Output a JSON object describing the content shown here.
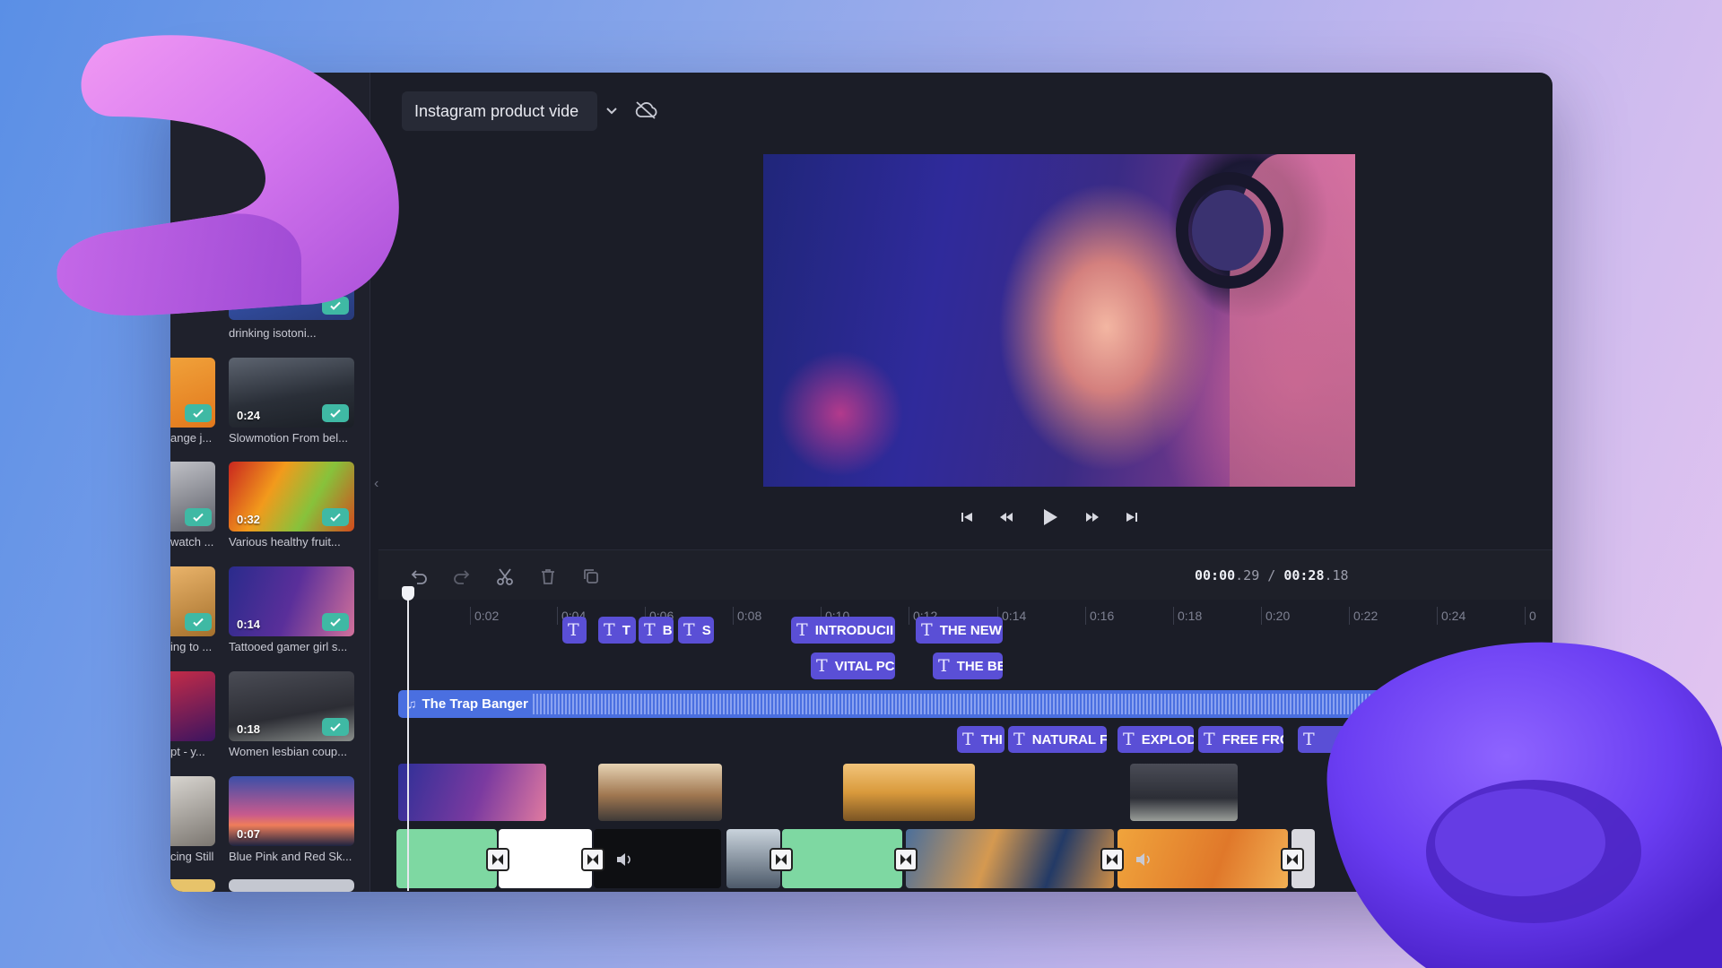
{
  "project": {
    "title": "Instagram product vide"
  },
  "library": {
    "items": [
      {
        "caption": "drinking isotoni...",
        "duration": "",
        "checked": true
      },
      {
        "caption": "Slowmotion From bel...",
        "duration": "0:24",
        "checked": true
      },
      {
        "caption": "Various healthy fruit...",
        "duration": "0:32",
        "checked": true
      },
      {
        "caption": "Tattooed gamer girl s...",
        "duration": "0:14",
        "checked": true
      },
      {
        "caption": "Women lesbian coup...",
        "duration": "0:18",
        "checked": true
      },
      {
        "caption": "Blue Pink and Red Sk...",
        "duration": "0:07",
        "checked": false
      }
    ],
    "left_column": [
      {
        "caption": "ange j...",
        "checked": true
      },
      {
        "caption": "watch ...",
        "checked": true
      },
      {
        "caption": "ing to ...",
        "checked": true
      },
      {
        "caption": "pt - y...",
        "checked": false
      },
      {
        "caption": "cing Still",
        "checked": false
      }
    ]
  },
  "transport": {
    "icons": [
      "skip-start-icon",
      "rewind-icon",
      "play-icon",
      "fast-forward-icon",
      "skip-end-icon"
    ]
  },
  "toolbar": {
    "icons": [
      "undo-icon",
      "redo-icon",
      "split-icon",
      "delete-icon",
      "duplicate-icon"
    ],
    "time_current_main": "00:00",
    "time_current_frac": ".29",
    "time_sep": " / ",
    "time_total_main": "00:28",
    "time_total_frac": ".18"
  },
  "timeline": {
    "ticks": [
      "0:02",
      "0:04",
      "0:06",
      "0:08",
      "0:10",
      "0:12",
      "0:14",
      "0:16",
      "0:18",
      "0:20",
      "0:22",
      "0:24",
      "0"
    ],
    "text_track_1": [
      "",
      "T",
      "B",
      "S",
      "INTRODUCII",
      "THE NEW"
    ],
    "text_track_2": [
      "VITAL PC",
      "THE BE"
    ],
    "audio_track": {
      "label": "The Trap Banger"
    },
    "text_track_3": [
      "THI",
      "NATURAL F",
      "EXPLOD",
      "FREE FRC",
      ""
    ]
  },
  "colors": {
    "accent": "#5a4fd6",
    "audio": "#4a6fe0",
    "check": "#3fb9a4",
    "window_bg": "#1b1d27"
  }
}
